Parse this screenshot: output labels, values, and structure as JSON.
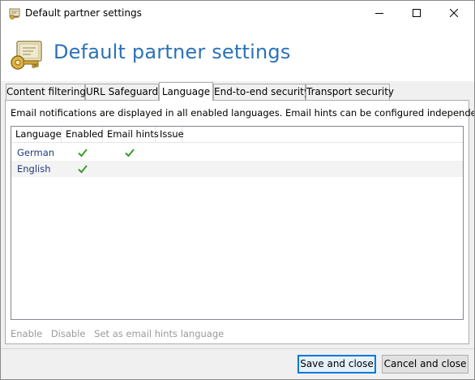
{
  "window": {
    "title": "Default partner settings"
  },
  "header": {
    "title": "Default partner settings"
  },
  "tabs": [
    {
      "label": "Content filtering"
    },
    {
      "label": "URL Safeguard"
    },
    {
      "label": "Language"
    },
    {
      "label": "End-to-end security"
    },
    {
      "label": "Transport security"
    }
  ],
  "active_tab": "Language",
  "language_panel": {
    "description": "Email notifications are displayed in all enabled languages. Email hints can be configured independently.",
    "columns": [
      "Language",
      "Enabled",
      "Email hints",
      "Issue"
    ],
    "rows": [
      {
        "language": "German",
        "enabled": true,
        "email_hints": true,
        "issue": ""
      },
      {
        "language": "English",
        "enabled": true,
        "email_hints": false,
        "issue": ""
      }
    ],
    "actions": {
      "enable": "Enable",
      "disable": "Disable",
      "set_hints": "Set as email hints language"
    }
  },
  "footer": {
    "save_label": "Save and close",
    "cancel_label": "Cancel and close"
  },
  "colors": {
    "accent": "#2b72b8",
    "check": "#3c9a2e",
    "language_text": "#1f3a7a"
  },
  "icons": {
    "title": "certificate-key-icon",
    "header": "certificate-key-icon",
    "check": "checkmark-icon"
  }
}
